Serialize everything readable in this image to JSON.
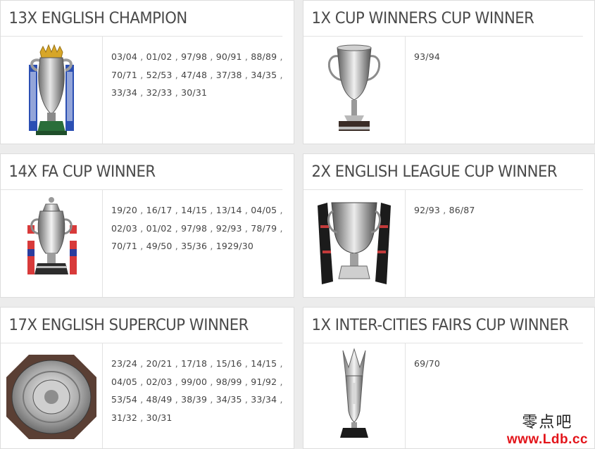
{
  "cards": [
    {
      "title": "13X ENGLISH CHAMPION",
      "trophy_icon": "premier-league-trophy",
      "seasons": [
        "03/04",
        "01/02",
        "97/98",
        "90/91",
        "88/89",
        "70/71",
        "52/53",
        "47/48",
        "37/38",
        "34/35",
        "33/34",
        "32/33",
        "30/31"
      ]
    },
    {
      "title": "1X CUP WINNERS CUP WINNER",
      "trophy_icon": "cup-winners-cup-trophy",
      "seasons": [
        "93/94"
      ]
    },
    {
      "title": "14X FA CUP WINNER",
      "trophy_icon": "fa-cup-trophy",
      "seasons": [
        "19/20",
        "16/17",
        "14/15",
        "13/14",
        "04/05",
        "02/03",
        "01/02",
        "97/98",
        "92/93",
        "78/79",
        "70/71",
        "49/50",
        "35/36",
        "1929/30"
      ]
    },
    {
      "title": "2X ENGLISH LEAGUE CUP WINNER",
      "trophy_icon": "league-cup-trophy",
      "seasons": [
        "92/93",
        "86/87"
      ]
    },
    {
      "title": "17X ENGLISH SUPERCUP WINNER",
      "trophy_icon": "community-shield-trophy",
      "seasons": [
        "23/24",
        "20/21",
        "17/18",
        "15/16",
        "14/15",
        "04/05",
        "02/03",
        "99/00",
        "98/99",
        "91/92",
        "53/54",
        "48/49",
        "38/39",
        "34/35",
        "33/34",
        "31/32",
        "30/31"
      ]
    },
    {
      "title": "1X INTER-CITIES FAIRS CUP WINNER",
      "trophy_icon": "fairs-cup-trophy",
      "seasons": [
        "69/70"
      ]
    }
  ],
  "separator": ",",
  "watermark": {
    "chinese": "零点吧",
    "url": "www.Ldb.cc"
  },
  "colors": {
    "background": "#ececec",
    "card": "#ffffff",
    "title_text": "#4a4a4a",
    "body_text": "#444444",
    "watermark_url": "#e3141a"
  }
}
